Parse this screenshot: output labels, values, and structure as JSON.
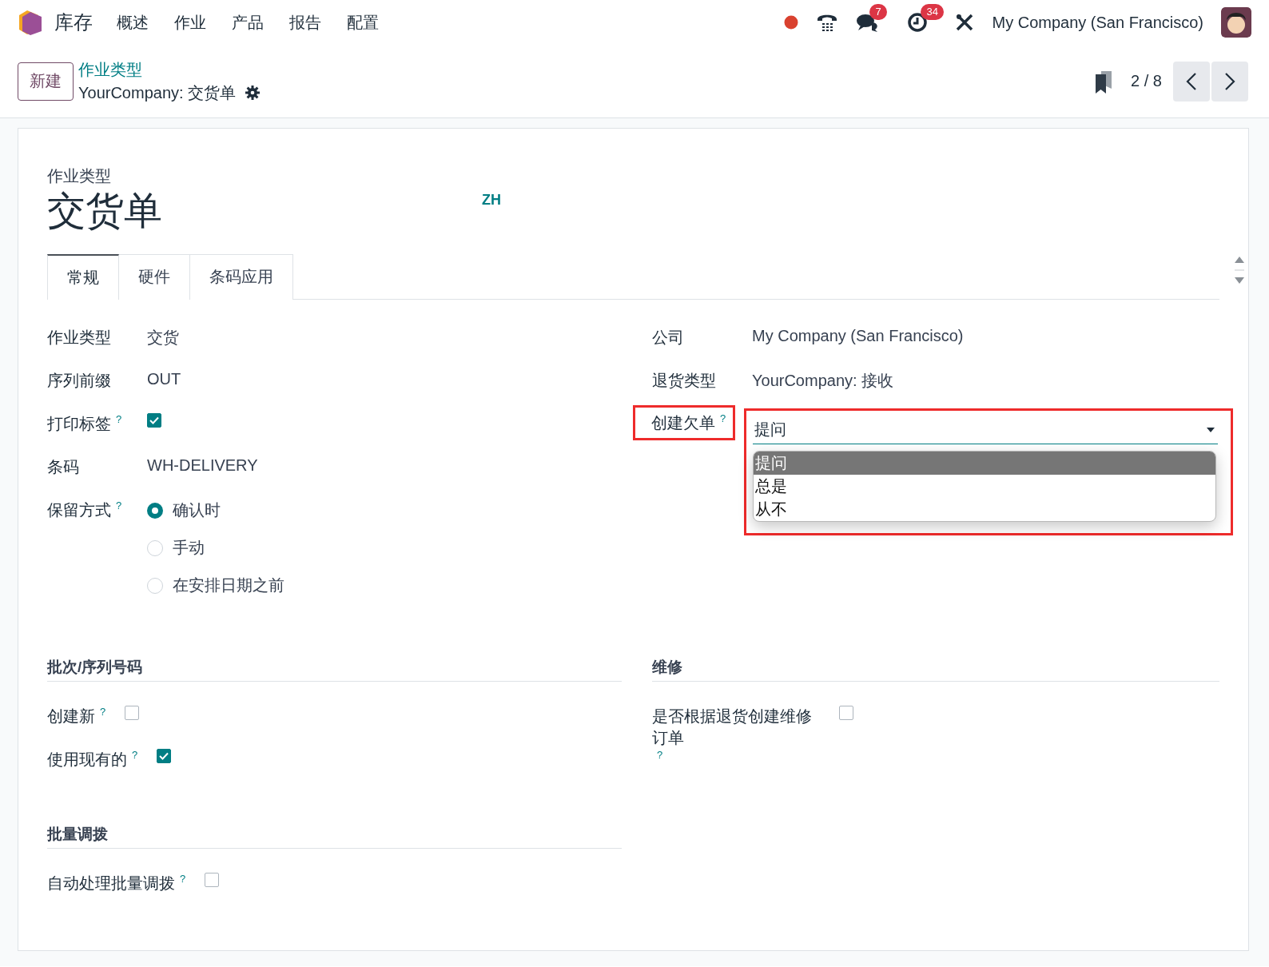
{
  "navbar": {
    "app_name": "库存",
    "menu": [
      "概述",
      "作业",
      "产品",
      "报告",
      "配置"
    ],
    "message_count": "7",
    "activity_count": "34",
    "company": "My Company (San Francisco)"
  },
  "control_panel": {
    "new_button": "新建",
    "breadcrumb": "作业类型",
    "record": "YourCompany: 交货单",
    "pager": "2 / 8"
  },
  "form": {
    "subtitle": "作业类型",
    "title": "交货单",
    "language": "ZH",
    "tabs": [
      {
        "label": "常规",
        "selected": true
      },
      {
        "label": "硬件",
        "selected": false
      },
      {
        "label": "条码应用",
        "selected": false
      }
    ],
    "left_fields": [
      {
        "kind": "text",
        "label": "作业类型",
        "value": "交货"
      },
      {
        "kind": "text",
        "label": "序列前缀",
        "value": "OUT"
      },
      {
        "kind": "checkbox",
        "label": "打印标签",
        "help": "?",
        "checked": true
      },
      {
        "kind": "text",
        "label": "条码",
        "value": "WH-DELIVERY"
      },
      {
        "kind": "radio",
        "label": "保留方式",
        "help": "?",
        "options": [
          {
            "label": "确认时",
            "selected": true
          },
          {
            "label": "手动",
            "selected": false
          },
          {
            "label": "在安排日期之前",
            "selected": false
          }
        ]
      }
    ],
    "right_fields": [
      {
        "kind": "text",
        "label": "公司",
        "value": "My Company (San Francisco)"
      },
      {
        "kind": "text",
        "label": "退货类型",
        "value": "YourCompany: 接收"
      },
      {
        "kind": "select",
        "label": "创建欠单",
        "help": "?",
        "highlighted": true,
        "value": "提问",
        "options": [
          {
            "label": "提问",
            "selected": true
          },
          {
            "label": "总是",
            "selected": false
          },
          {
            "label": "从不",
            "selected": false
          }
        ]
      }
    ],
    "left_sections": [
      {
        "title": "批次/序列号码",
        "fields": [
          {
            "label": "创建新",
            "help": "?",
            "checked": false
          },
          {
            "label": "使用现有的",
            "help": "?",
            "checked": true
          }
        ]
      },
      {
        "title": "批量调拨",
        "fields": [
          {
            "label": "自动处理批量调拨",
            "help": "?",
            "checked": false
          }
        ]
      }
    ],
    "right_sections": [
      {
        "title": "维修",
        "fields": [
          {
            "label": "是否根据退货创建维修订单",
            "help": "?",
            "checked": false
          }
        ]
      }
    ]
  }
}
